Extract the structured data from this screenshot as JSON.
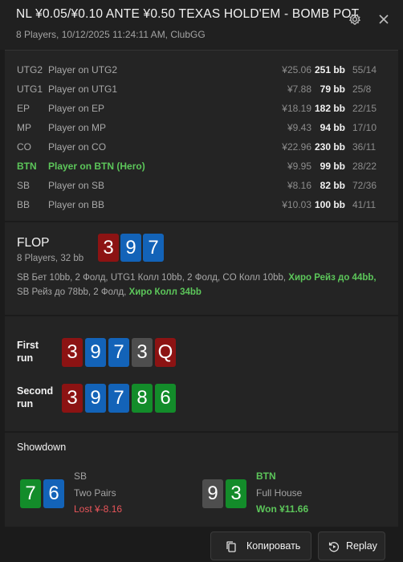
{
  "header": {
    "title": "NL ¥0.05/¥0.10 ANTE ¥0.50 TEXAS HOLD'EM - BOMB POT",
    "subtitle": "8 Players, 10/12/2025 11:24:11 AM, ClubGG"
  },
  "players": [
    {
      "pos": "UTG2",
      "name": "Player on UTG2",
      "money": "¥25.06",
      "bb": "251 bb",
      "stat": "55/14",
      "hero": false
    },
    {
      "pos": "UTG1",
      "name": "Player on UTG1",
      "money": "¥7.88",
      "bb": "79 bb",
      "stat": "25/8",
      "hero": false
    },
    {
      "pos": "EP",
      "name": "Player on EP",
      "money": "¥18.19",
      "bb": "182 bb",
      "stat": "22/15",
      "hero": false
    },
    {
      "pos": "MP",
      "name": "Player on MP",
      "money": "¥9.43",
      "bb": "94 bb",
      "stat": "17/10",
      "hero": false
    },
    {
      "pos": "CO",
      "name": "Player on CO",
      "money": "¥22.96",
      "bb": "230 bb",
      "stat": "36/11",
      "hero": false
    },
    {
      "pos": "BTN",
      "name": "Player on BTN (Hero)",
      "money": "¥9.95",
      "bb": "99 bb",
      "stat": "28/22",
      "hero": true
    },
    {
      "pos": "SB",
      "name": "Player on SB",
      "money": "¥8.16",
      "bb": "82 bb",
      "stat": "72/36",
      "hero": false
    },
    {
      "pos": "BB",
      "name": "Player on BB",
      "money": "¥10.03",
      "bb": "100 bb",
      "stat": "41/11",
      "hero": false
    }
  ],
  "flop": {
    "title": "FLOP",
    "subtitle": "8 Players, 32 bb",
    "cards": [
      {
        "rank": "3",
        "color": "red"
      },
      {
        "rank": "9",
        "color": "blue"
      },
      {
        "rank": "7",
        "color": "blue"
      }
    ],
    "action_line1_plain": "SB Бет 10bb, 2 Фолд, UTG1 Колл 10bb, 2 Фолд, CO Колл 10bb, ",
    "action_line1_hero": "Хиро Рейз до 44bb,",
    "action_line2_plain": "SB Рейз до 78bb, 2 Фолд, ",
    "action_line2_hero": "Хиро Колл 34bb"
  },
  "runs": {
    "first_label": "First run",
    "first_cards": [
      {
        "rank": "3",
        "color": "red"
      },
      {
        "rank": "9",
        "color": "blue"
      },
      {
        "rank": "7",
        "color": "blue"
      },
      {
        "rank": "3",
        "color": "gray"
      },
      {
        "rank": "Q",
        "color": "red"
      }
    ],
    "second_label": "Second run",
    "second_cards": [
      {
        "rank": "3",
        "color": "red"
      },
      {
        "rank": "9",
        "color": "blue"
      },
      {
        "rank": "7",
        "color": "blue"
      },
      {
        "rank": "8",
        "color": "green"
      },
      {
        "rank": "6",
        "color": "green"
      }
    ]
  },
  "showdown": {
    "title": "Showdown",
    "left": {
      "cards": [
        {
          "rank": "7",
          "color": "green"
        },
        {
          "rank": "6",
          "color": "blue"
        }
      ],
      "pos": "SB",
      "hand": "Two Pairs",
      "result": "Lost ¥-8.16"
    },
    "right": {
      "cards": [
        {
          "rank": "9",
          "color": "gray"
        },
        {
          "rank": "3",
          "color": "green"
        }
      ],
      "pos": "BTN",
      "hand": "Full House",
      "result": "Won ¥11.66"
    }
  },
  "buttons": {
    "copy_label": "Копировать",
    "replay_label": "Replay"
  },
  "colors": {
    "hero_green": "#5cc65a",
    "lost_red": "#e8555a",
    "card_red": "#8c1313",
    "card_blue": "#1363b8",
    "card_green": "#138c2a",
    "card_gray": "#4e4e4e"
  },
  "icons": [
    "gear-icon",
    "close-icon",
    "copy-icon",
    "replay-icon"
  ]
}
